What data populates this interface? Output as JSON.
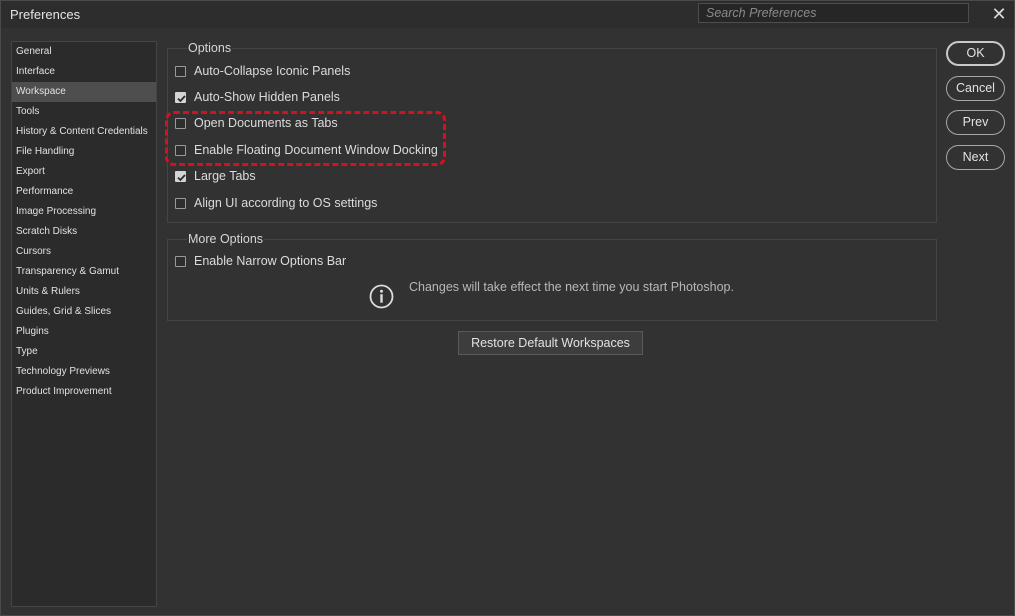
{
  "window": {
    "title": "Preferences",
    "close_glyph": "✕"
  },
  "search": {
    "placeholder": "Search Preferences"
  },
  "sidebar": {
    "selected": "Workspace",
    "items": [
      "General",
      "Interface",
      "Workspace",
      "Tools",
      "History & Content Credentials",
      "File Handling",
      "Export",
      "Performance",
      "Image Processing",
      "Scratch Disks",
      "Cursors",
      "Transparency & Gamut",
      "Units & Rulers",
      "Guides, Grid & Slices",
      "Plugins",
      "Type",
      "Technology Previews",
      "Product Improvement"
    ]
  },
  "options": {
    "title": "Options",
    "items": [
      {
        "label": "Auto-Collapse Iconic Panels",
        "checked": false
      },
      {
        "label": "Auto-Show Hidden Panels",
        "checked": true
      },
      {
        "label": "Open Documents as Tabs",
        "checked": false
      },
      {
        "label": "Enable Floating Document Window Docking",
        "checked": false
      },
      {
        "label": "Large Tabs",
        "checked": true
      },
      {
        "label": "Align UI according to OS settings",
        "checked": false
      }
    ]
  },
  "more_options": {
    "title": "More Options",
    "items": [
      {
        "label": "Enable Narrow Options Bar",
        "checked": false
      }
    ],
    "info": "Changes will take effect the next time you start Photoshop."
  },
  "restore_label": "Restore Default Workspaces",
  "buttons": {
    "ok": "OK",
    "cancel": "Cancel",
    "prev": "Prev",
    "next": "Next"
  },
  "colors": {
    "highlight": "#d11220",
    "background": "#323232"
  },
  "icons": {
    "close": "close-icon",
    "info": "info-icon",
    "checkmark": "checkmark-icon"
  }
}
